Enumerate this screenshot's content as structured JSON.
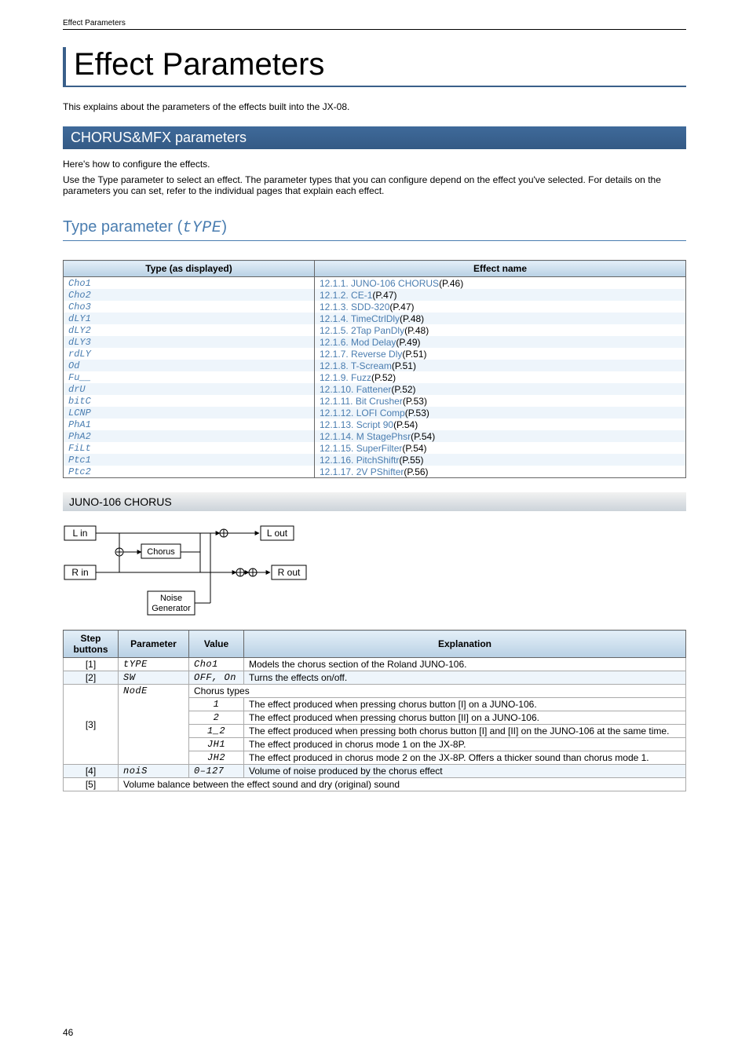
{
  "header": {
    "running_head": "Effect Parameters"
  },
  "title": "Effect Parameters",
  "intro": "This explains about the parameters of the effects built into the JX-08.",
  "section1": {
    "heading": "CHORUS&MFX parameters",
    "desc1": "Here's how to configure the effects.",
    "desc2": "Use the Type parameter to select an effect. The parameter types that you can configure depend on the effect you've selected. For details on the parameters you can set, refer to the individual pages that explain each effect."
  },
  "type_param": {
    "heading_prefix": "Type parameter (",
    "heading_code": "tYPE",
    "heading_suffix": ")",
    "cols": {
      "type": "Type (as displayed)",
      "effect": "Effect name"
    },
    "rows": [
      {
        "type": "Cho1",
        "link": "12.1.1. JUNO-106 CHORUS",
        "page": "(P.46)"
      },
      {
        "type": "Cho2",
        "link": "12.1.2. CE-1",
        "page": "(P.47)"
      },
      {
        "type": "Cho3",
        "link": "12.1.3. SDD-320",
        "page": "(P.47)"
      },
      {
        "type": "dLY1",
        "link": "12.1.4. TimeCtrlDly",
        "page": "(P.48)"
      },
      {
        "type": "dLY2",
        "link": "12.1.5. 2Tap PanDly",
        "page": "(P.48)"
      },
      {
        "type": "dLY3",
        "link": "12.1.6. Mod Delay",
        "page": "(P.49)"
      },
      {
        "type": "rdLY",
        "link": "12.1.7. Reverse Dly",
        "page": "(P.51)"
      },
      {
        "type": "Od",
        "link": "12.1.8. T-Scream",
        "page": "(P.51)"
      },
      {
        "type": "Fu__",
        "link": "12.1.9. Fuzz",
        "page": "(P.52)"
      },
      {
        "type": "drU",
        "link": "12.1.10. Fattener",
        "page": "(P.52)"
      },
      {
        "type": "bitC",
        "link": "12.1.11. Bit Crusher",
        "page": "(P.53)"
      },
      {
        "type": "LCNP",
        "link": "12.1.12. LOFI Comp",
        "page": "(P.53)"
      },
      {
        "type": "PhA1",
        "link": "12.1.13. Script 90",
        "page": "(P.54)"
      },
      {
        "type": "PhA2",
        "link": "12.1.14. M StagePhsr",
        "page": "(P.54)"
      },
      {
        "type": "FiLt",
        "link": "12.1.15. SuperFilter",
        "page": "(P.54)"
      },
      {
        "type": "Ptc1",
        "link": "12.1.16. PitchShiftr",
        "page": "(P.55)"
      },
      {
        "type": "Ptc2",
        "link": "12.1.17. 2V PShifter",
        "page": "(P.56)"
      }
    ]
  },
  "subsection": {
    "heading": "JUNO-106 CHORUS",
    "diagram": {
      "l_in": "L in",
      "r_in": "R in",
      "l_out": "L out",
      "r_out": "R out",
      "chorus": "Chorus",
      "noise1": "Noise",
      "noise2": "Generator"
    },
    "cols": {
      "step": "Step buttons",
      "param": "Parameter",
      "value": "Value",
      "expl": "Explanation"
    },
    "rows": {
      "r1": {
        "step": "[1]",
        "param": "tYPE",
        "value": "Cho1",
        "expl": "Models the chorus section of the Roland JUNO-106."
      },
      "r2": {
        "step": "[2]",
        "param": "SW",
        "value": "OFF, On",
        "expl": "Turns the effects on/off."
      },
      "r3": {
        "step": "[3]",
        "param": "NodE",
        "expl_header": "Chorus types",
        "sub": [
          {
            "value": "1",
            "expl": "The effect produced when pressing chorus button [I] on a JUNO-106."
          },
          {
            "value": "2",
            "expl": "The effect produced when pressing chorus button [II] on a JUNO-106."
          },
          {
            "value": "1_2",
            "expl": "The effect produced when pressing both chorus button [I] and [II] on the JUNO-106 at the same time."
          },
          {
            "value": "JH1",
            "expl": "The effect produced in chorus mode 1 on the JX-8P."
          },
          {
            "value": "JH2",
            "expl": "The effect produced in chorus mode 2 on the JX-8P. Offers a thicker sound than chorus mode 1."
          }
        ]
      },
      "r4": {
        "step": "[4]",
        "param": "noiS",
        "value": "0–127",
        "expl": "Volume of noise produced by the chorus effect"
      },
      "r5": {
        "step": "[5]",
        "expl": "Volume balance between the effect sound and dry (original) sound"
      }
    }
  },
  "page_number": "46"
}
